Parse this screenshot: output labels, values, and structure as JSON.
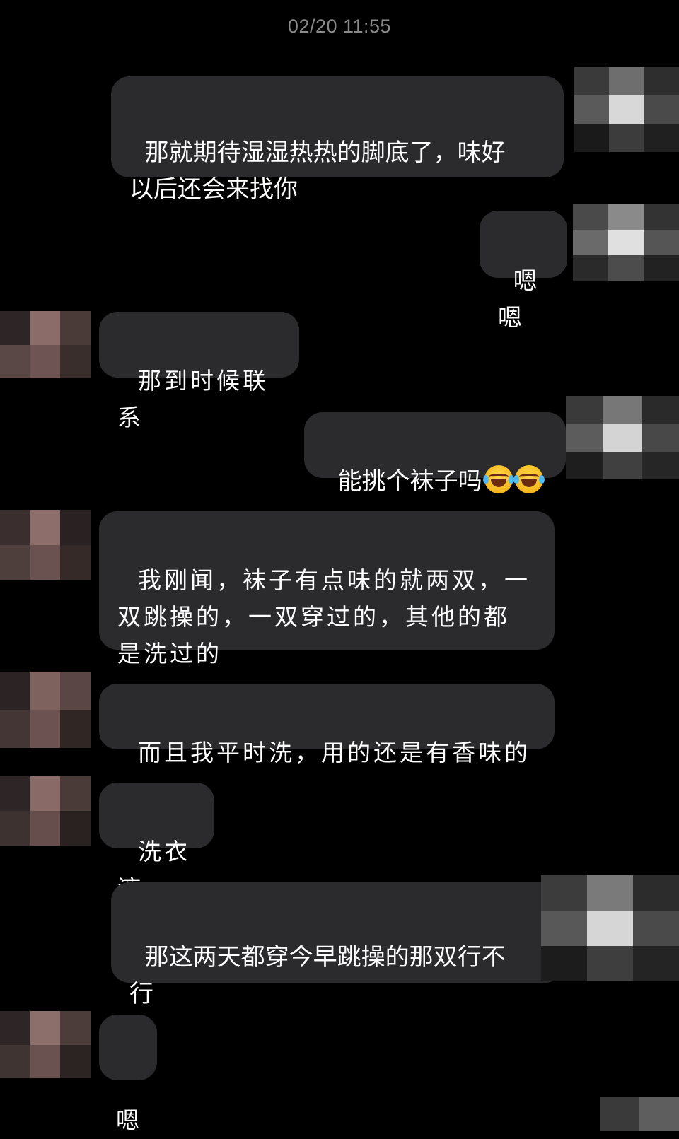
{
  "timestamp": "02/20 11:55",
  "messages": [
    {
      "side": "out",
      "text": "那就期待湿湿热热的脚底了，味好\n以后还会来找你"
    },
    {
      "side": "out",
      "text": "嗯嗯"
    },
    {
      "side": "in",
      "text": "那到时候联系"
    },
    {
      "side": "out",
      "text": "能挑个袜子吗",
      "emoji": [
        "tears-of-joy-emoji",
        "tears-of-joy-emoji"
      ]
    },
    {
      "side": "in",
      "text": "我刚闻，袜子有点味的就两双，一\n双跳操的，一双穿过的，其他的都\n是洗过的"
    },
    {
      "side": "in",
      "text": "而且我平时洗，用的还是有香味的"
    },
    {
      "side": "in",
      "text": "洗衣液"
    },
    {
      "side": "out",
      "text": "那这两天都穿今早跳操的那双行不\n行"
    },
    {
      "side": "in",
      "text": "嗯"
    }
  ],
  "colors": {
    "background": "#000000",
    "bubble": "#2b2b2d",
    "timestamp": "#8a8a8a",
    "text": "#ffffff"
  }
}
